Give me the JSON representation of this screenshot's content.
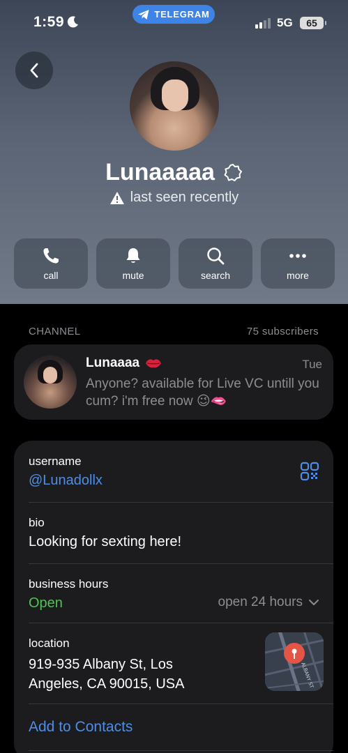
{
  "status_bar": {
    "time": "1:59",
    "pill_label": "TELEGRAM",
    "network": "5G",
    "battery": "65"
  },
  "profile": {
    "name": "Lunaaaaa",
    "status": "last seen recently"
  },
  "actions": [
    {
      "label": "call",
      "icon": "phone-icon"
    },
    {
      "label": "mute",
      "icon": "bell-icon"
    },
    {
      "label": "search",
      "icon": "search-icon"
    },
    {
      "label": "more",
      "icon": "more-icon"
    }
  ],
  "channel": {
    "section_label": "CHANNEL",
    "subscribers": "75 subscribers",
    "name": "Lunaaaa",
    "time": "Tue",
    "message": "Anyone? available for Live VC untill you cum? i'm free now 😉🫦"
  },
  "info": {
    "username_label": "username",
    "username": "@Lunadollx",
    "bio_label": "bio",
    "bio": "Looking for sexting here!",
    "hours_label": "business hours",
    "hours_status": "Open",
    "hours_detail": "open 24 hours",
    "location_label": "location",
    "location_line1": "919-935 Albany St, Los",
    "location_line2": "Angeles, CA 90015, USA",
    "map_street": "ALBANY ST",
    "add_contacts": "Add to Contacts"
  },
  "colors": {
    "accent": "#4e8ee6",
    "open_green": "#4fc356",
    "telegram_blue": "#3d84e6"
  }
}
